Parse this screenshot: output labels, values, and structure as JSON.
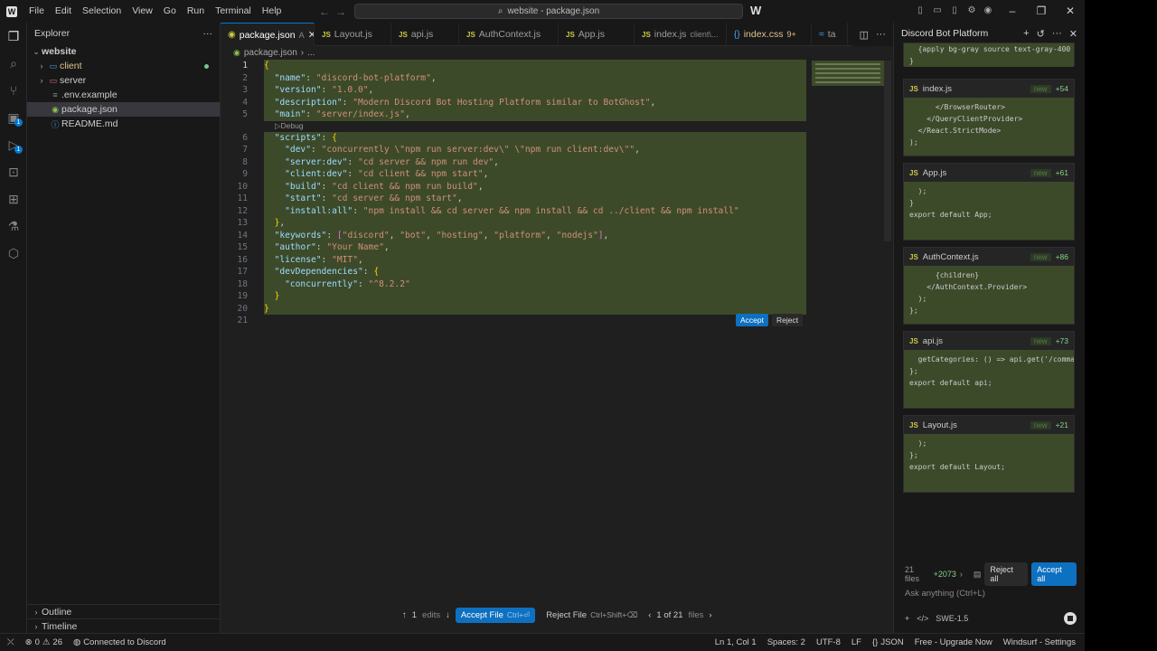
{
  "menu": [
    "File",
    "Edit",
    "Selection",
    "View",
    "Go",
    "Run",
    "Terminal",
    "Help"
  ],
  "command_center": "website - package.json",
  "explorer": {
    "title": "Explorer",
    "root": "website",
    "items": [
      {
        "label": "client",
        "type": "folder",
        "color": "#e2c08d"
      },
      {
        "label": "server",
        "type": "folder",
        "color": "#cccccc"
      },
      {
        "label": ".env.example",
        "type": "file",
        "color": "#cccccc"
      },
      {
        "label": "package.json",
        "type": "file",
        "color": "#cccccc"
      },
      {
        "label": "README.md",
        "type": "file",
        "color": "#cccccc"
      }
    ],
    "outline": "Outline",
    "timeline": "Timeline"
  },
  "tabs": [
    {
      "label": "package.json",
      "suffix": "A",
      "icon": "json"
    },
    {
      "label": "Layout.js",
      "icon": "js"
    },
    {
      "label": "api.js",
      "icon": "js"
    },
    {
      "label": "AuthContext.js",
      "icon": "js"
    },
    {
      "label": "App.js",
      "icon": "js"
    },
    {
      "label": "index.js",
      "desc": "client\\...",
      "icon": "js"
    },
    {
      "label": "index.css",
      "desc": "9+",
      "icon": "css"
    },
    {
      "label": "ta",
      "icon": "other"
    }
  ],
  "breadcrumb": {
    "file": "package.json",
    "more": "..."
  },
  "codelens": "▷Debug",
  "code_lines": [
    "{",
    "  \"name\": \"discord-bot-platform\",",
    "  \"version\": \"1.0.0\",",
    "  \"description\": \"Modern Discord Bot Hosting Platform similar to BotGhost\",",
    "  \"main\": \"server/index.js\",",
    "  \"scripts\": {",
    "    \"dev\": \"concurrently \\\"npm run server:dev\\\" \\\"npm run client:dev\\\"\",",
    "    \"server:dev\": \"cd server && npm run dev\",",
    "    \"client:dev\": \"cd client && npm start\",",
    "    \"build\": \"cd client && npm run build\",",
    "    \"start\": \"cd server && npm start\",",
    "    \"install:all\": \"npm install && cd server && npm install && cd ../client && npm install\"",
    "  },",
    "  \"keywords\": [\"discord\", \"bot\", \"hosting\", \"platform\", \"nodejs\"],",
    "  \"author\": \"Your Name\",",
    "  \"license\": \"MIT\",",
    "  \"devDependencies\": {",
    "    \"concurrently\": \"^8.2.2\"",
    "  }",
    "}",
    ""
  ],
  "inline_actions": {
    "accept": "Accept",
    "reject": "Reject"
  },
  "bottom_bar": {
    "edits_count": "1",
    "edits_label": "edits",
    "accept_file": "Accept File",
    "accept_kbd": "Ctrl+⏎",
    "reject_file": "Reject File",
    "reject_kbd": "Ctrl+Shift+⌫",
    "file_pos": "1 of 21",
    "files_label": "files"
  },
  "panel": {
    "title": "Discord Bot Platform",
    "top_snippet": "  {apply bg-gray source text-gray-400 ...}\n}",
    "cards": [
      {
        "file": "index.js",
        "badge": "new",
        "count": "+54",
        "lines": [
          "      </BrowserRouter>",
          "    </QueryClientProvider>",
          "  </React.StrictMode>",
          ");"
        ]
      },
      {
        "file": "App.js",
        "badge": "new",
        "count": "+61",
        "lines": [
          "  );",
          "}",
          "",
          "export default App;"
        ]
      },
      {
        "file": "AuthContext.js",
        "badge": "new",
        "count": "+86",
        "lines": [
          "      {children}",
          "    </AuthContext.Provider>",
          "  );",
          "};"
        ]
      },
      {
        "file": "api.js",
        "badge": "new",
        "count": "+73",
        "lines": [
          "  getCategories: () => api.get('/commands/c",
          "};",
          "",
          "export default api;"
        ]
      },
      {
        "file": "Layout.js",
        "badge": "new",
        "count": "+21",
        "lines": [
          "  );",
          "};",
          "",
          "export default Layout;"
        ]
      }
    ],
    "files_summary": "21 files",
    "files_added": "+2073",
    "reject_all": "Reject all",
    "accept_all": "Accept all",
    "ask_placeholder": "Ask anything (Ctrl+L)",
    "model": "SWE-1.5"
  },
  "status": {
    "errors": "0",
    "warnings": "26",
    "discord": "Connected to Discord",
    "position": "Ln 1, Col 1",
    "spaces": "Spaces: 2",
    "encoding": "UTF-8",
    "eol": "LF",
    "language": "JSON",
    "upgrade": "Free - Upgrade Now",
    "settings": "Windsurf - Settings"
  }
}
